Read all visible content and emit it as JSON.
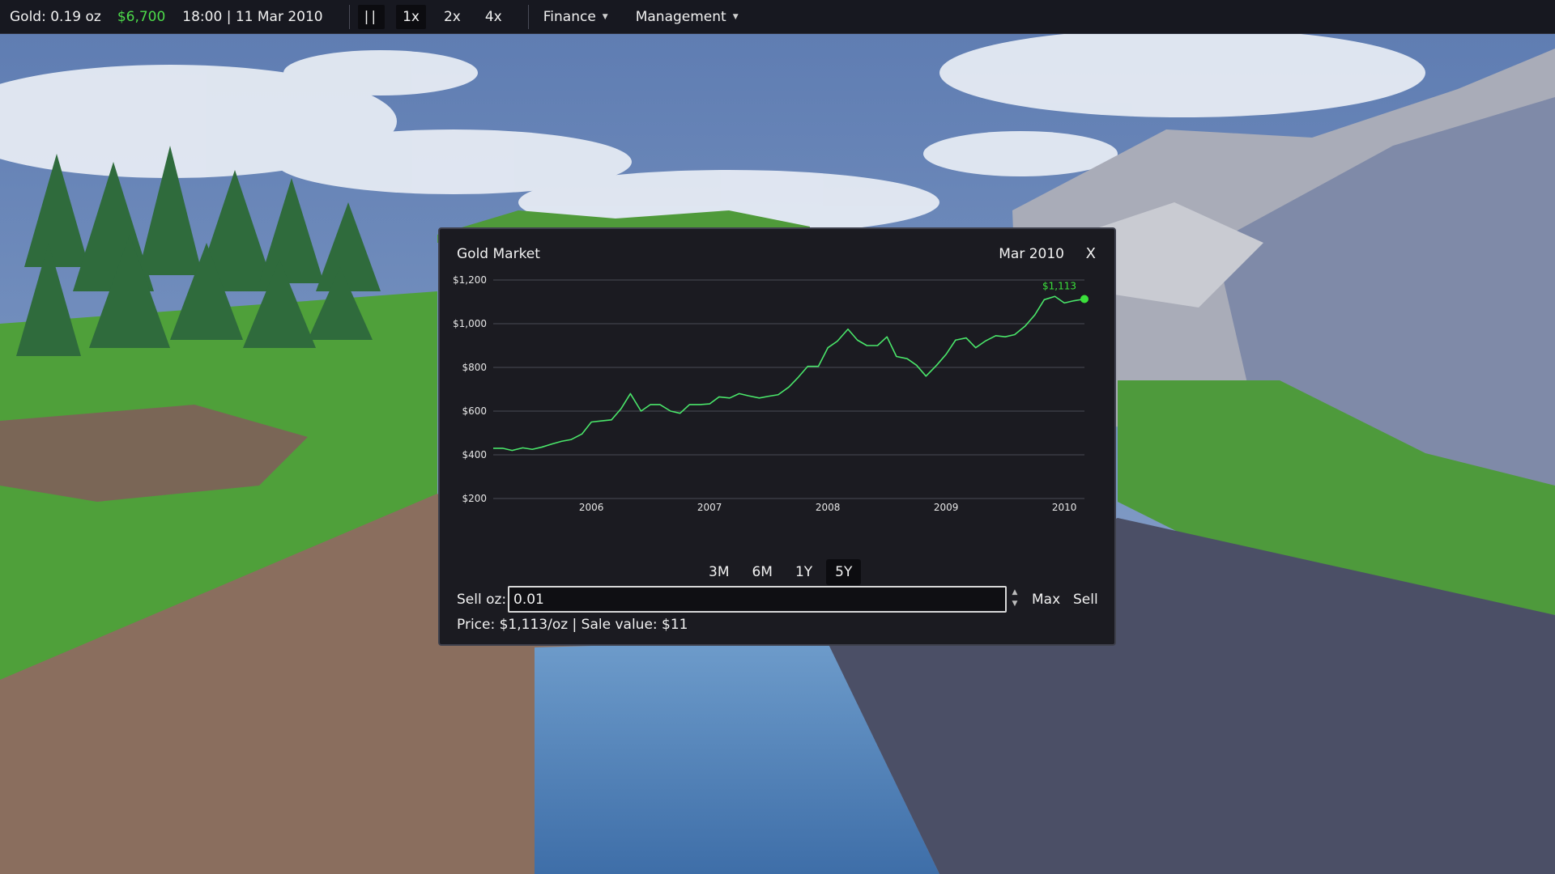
{
  "topbar": {
    "gold": "Gold: 0.19 oz",
    "money": "$6,700",
    "money_color": "#4ddb4a",
    "datetime": "18:00 | 11 Mar 2010",
    "pause_label": "||",
    "speeds": [
      "1x",
      "2x",
      "4x"
    ],
    "active_speed": "1x",
    "menus": [
      "Finance",
      "Management"
    ]
  },
  "modal": {
    "title": "Gold Market",
    "date": "Mar 2010",
    "close": "X",
    "ranges": [
      "3M",
      "6M",
      "1Y",
      "5Y"
    ],
    "active_range": "5Y",
    "sell_label": "Sell oz:",
    "sell_value": "0.01",
    "max_label": "Max",
    "sell_button": "Sell",
    "price_line": "Price: $1,113/oz | Sale value: $11"
  },
  "chart_data": {
    "type": "line",
    "title": "",
    "xlabel": "",
    "ylabel": "",
    "line_color": "#4ae66a",
    "last_label": "$1,113",
    "last_label_color": "#3be03b",
    "y_ticks": [
      "$1,200",
      "$1,000",
      "$800",
      "$600",
      "$400",
      "$200"
    ],
    "y_tick_values": [
      1200,
      1000,
      800,
      600,
      400,
      200
    ],
    "x_ticks": [
      "2006",
      "2007",
      "2008",
      "2009",
      "2010"
    ],
    "x_tick_values": [
      2006.0,
      2007.0,
      2008.0,
      2009.0,
      2010.0
    ],
    "ylim": [
      200,
      1200
    ],
    "xlim": [
      2005.17,
      2010.17
    ],
    "grid": true,
    "series": [
      {
        "x": [
          2005.17,
          2005.25,
          2005.33,
          2005.42,
          2005.5,
          2005.58,
          2005.67,
          2005.75,
          2005.83,
          2005.92,
          2006.0,
          2006.08,
          2006.17,
          2006.25,
          2006.33,
          2006.42,
          2006.5,
          2006.58,
          2006.67,
          2006.75,
          2006.83,
          2006.92,
          2007.0,
          2007.08,
          2007.17,
          2007.25,
          2007.33,
          2007.42,
          2007.5,
          2007.58,
          2007.67,
          2007.75,
          2007.83,
          2007.92,
          2008.0,
          2008.08,
          2008.17,
          2008.25,
          2008.33,
          2008.42,
          2008.5,
          2008.58,
          2008.67,
          2008.75,
          2008.83,
          2008.92,
          2009.0,
          2009.08,
          2009.17,
          2009.25,
          2009.33,
          2009.42,
          2009.5,
          2009.58,
          2009.67,
          2009.75,
          2009.83,
          2009.92,
          2010.0,
          2010.08,
          2010.17
        ],
        "values": [
          430,
          430,
          420,
          432,
          425,
          435,
          450,
          462,
          470,
          495,
          550,
          555,
          560,
          610,
          680,
          600,
          630,
          630,
          600,
          590,
          630,
          630,
          633,
          665,
          660,
          680,
          670,
          660,
          668,
          675,
          710,
          755,
          805,
          805,
          890,
          920,
          975,
          925,
          900,
          900,
          940,
          850,
          840,
          810,
          760,
          810,
          860,
          925,
          935,
          890,
          920,
          945,
          940,
          950,
          990,
          1040,
          1110,
          1125,
          1095,
          1105,
          1113
        ]
      }
    ]
  }
}
